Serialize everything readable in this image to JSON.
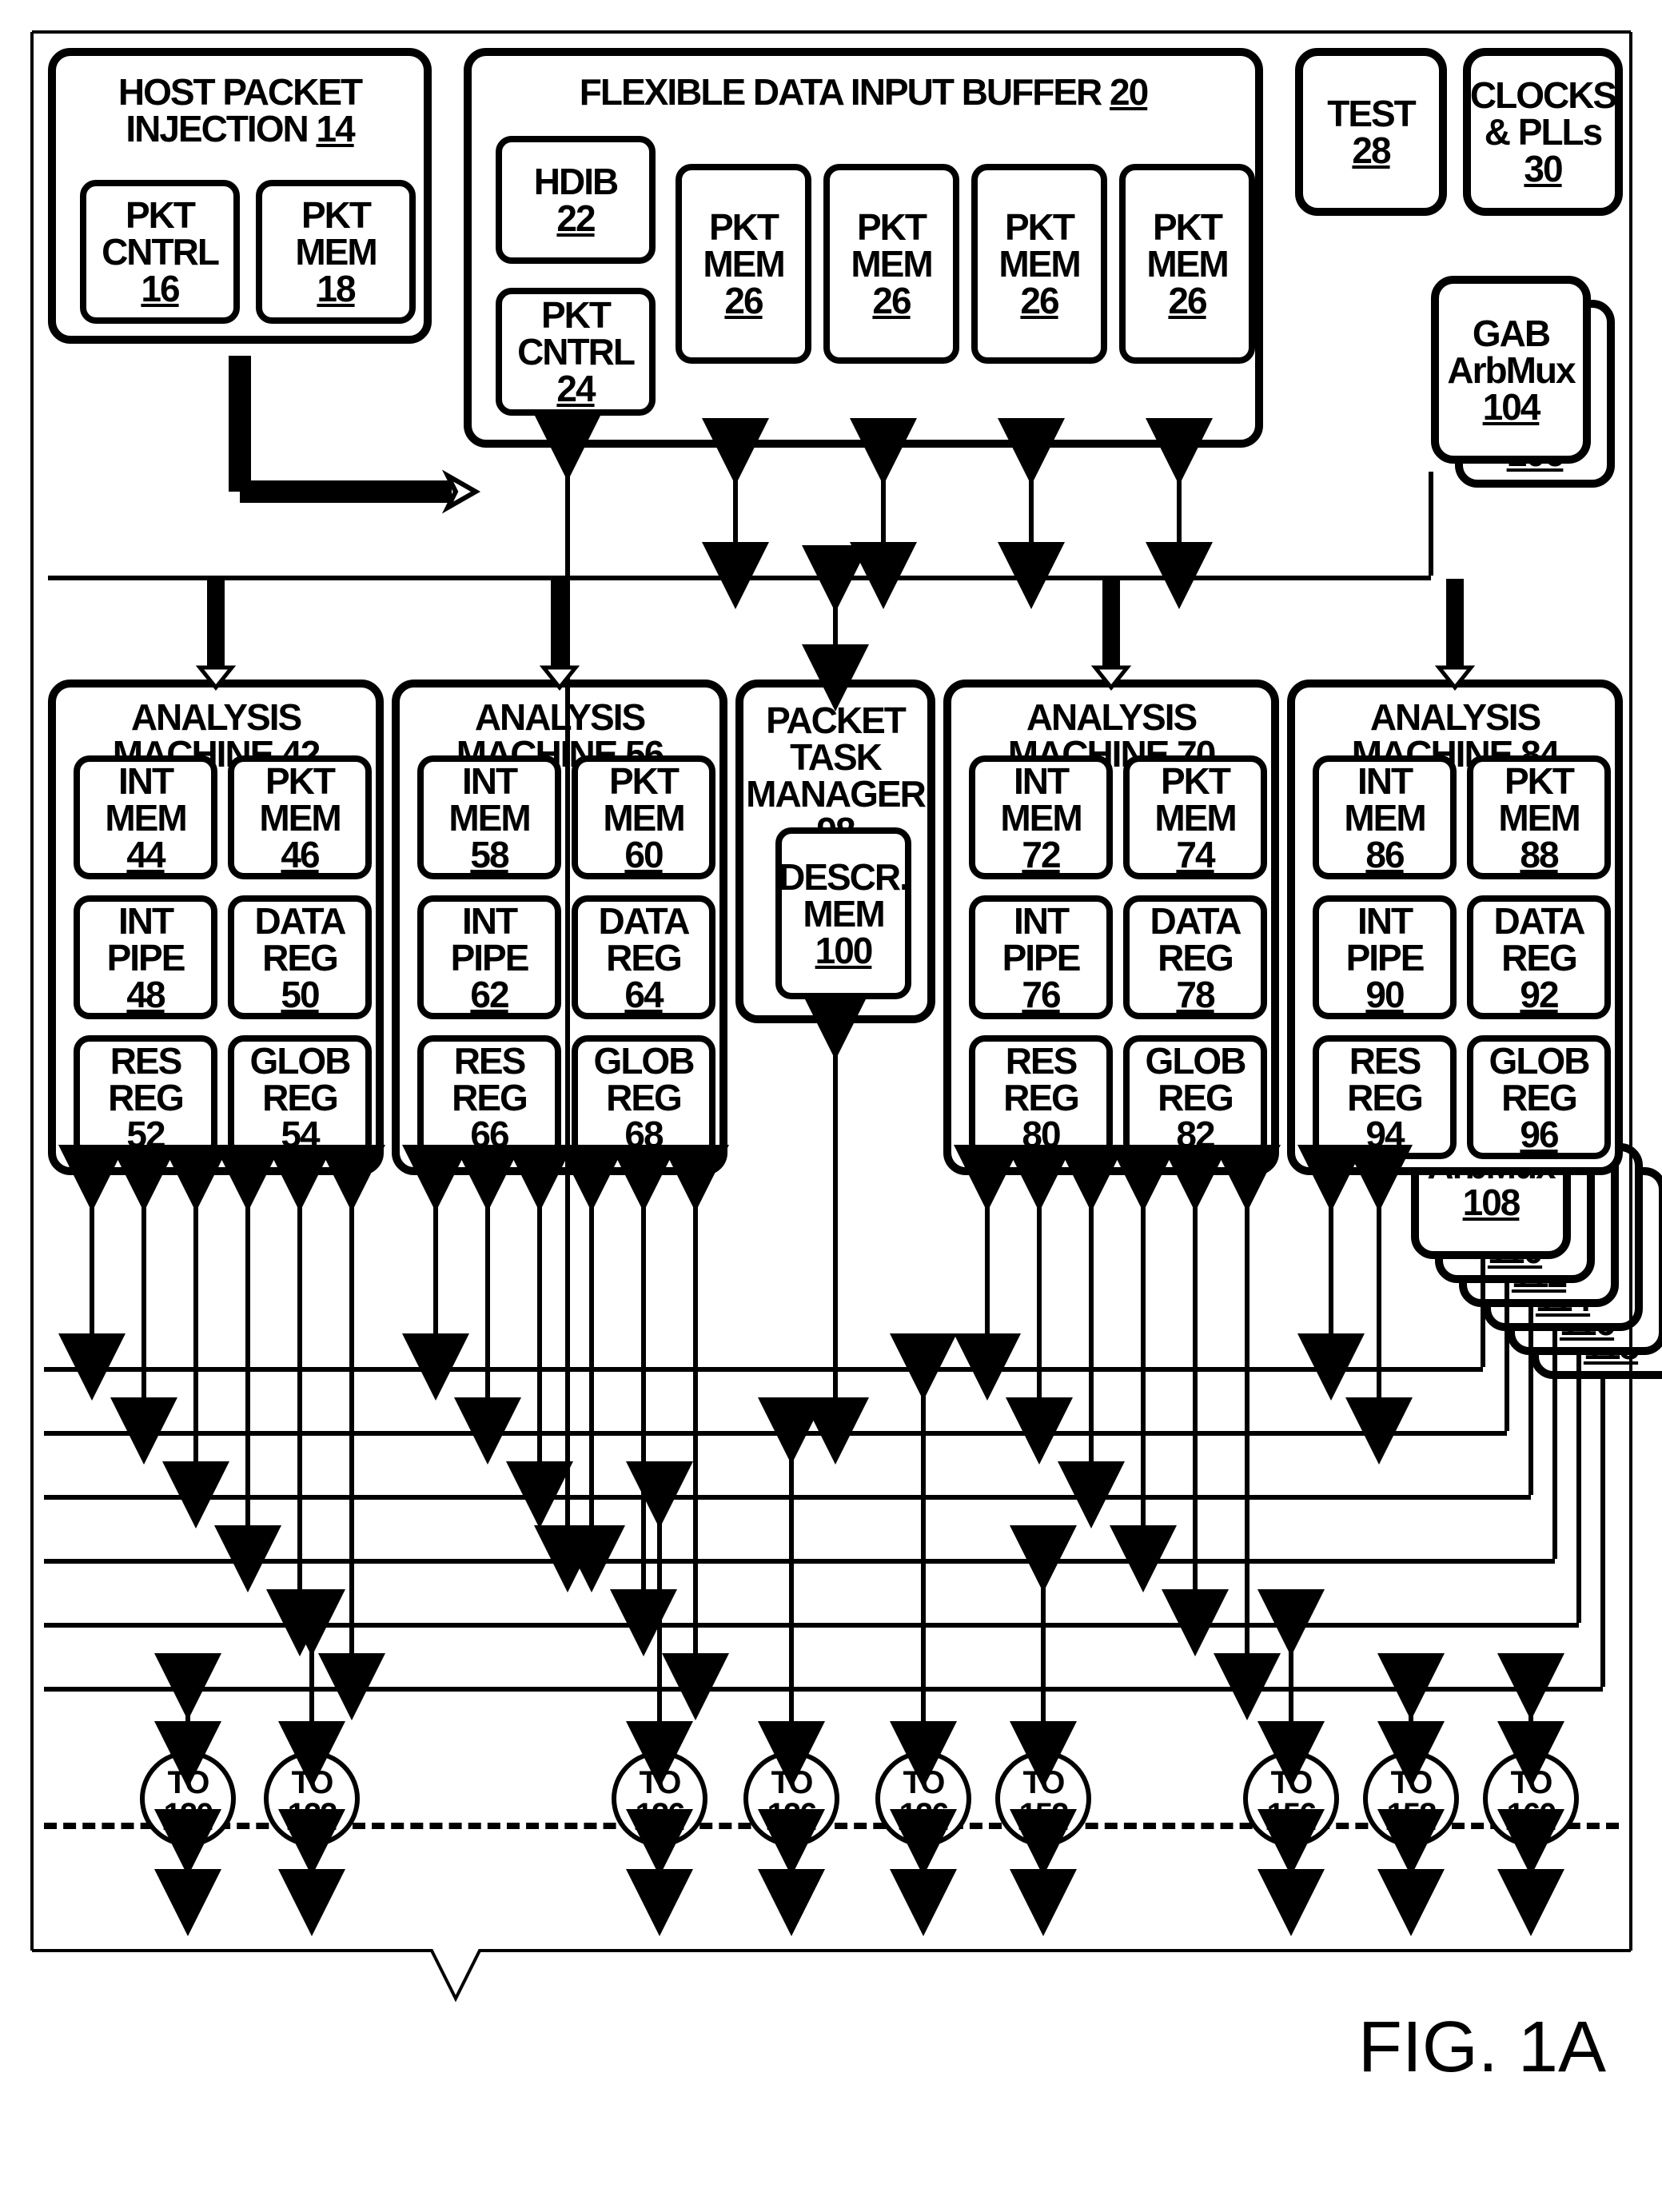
{
  "figure_label": "FIG. 1A",
  "chart_data": {
    "type": "block-diagram",
    "blocks": [
      {
        "id": 14,
        "name": "HOST PACKET INJECTION",
        "children": [
          {
            "id": 16,
            "name": "PKT CNTRL"
          },
          {
            "id": 18,
            "name": "PKT MEM"
          }
        ]
      },
      {
        "id": 20,
        "name": "FLEXIBLE DATA INPUT BUFFER",
        "children": [
          {
            "id": 22,
            "name": "HDIB"
          },
          {
            "id": 24,
            "name": "PKT CNTRL"
          },
          {
            "id": 26,
            "name": "PKT MEM",
            "count": 4
          }
        ]
      },
      {
        "id": 28,
        "name": "TEST"
      },
      {
        "id": 30,
        "name": "CLOCKS & PLLs"
      },
      {
        "id": 42,
        "name": "ANALYSIS MACHINE",
        "children": [
          {
            "id": 44,
            "name": "INT MEM"
          },
          {
            "id": 46,
            "name": "PKT MEM"
          },
          {
            "id": 48,
            "name": "INT PIPE"
          },
          {
            "id": 50,
            "name": "DATA REG"
          },
          {
            "id": 52,
            "name": "RES REG"
          },
          {
            "id": 54,
            "name": "GLOB REG"
          }
        ]
      },
      {
        "id": 56,
        "name": "ANALYSIS MACHINE",
        "children": [
          {
            "id": 58,
            "name": "INT MEM"
          },
          {
            "id": 60,
            "name": "PKT MEM"
          },
          {
            "id": 62,
            "name": "INT PIPE"
          },
          {
            "id": 64,
            "name": "DATA REG"
          },
          {
            "id": 66,
            "name": "RES REG"
          },
          {
            "id": 68,
            "name": "GLOB REG"
          }
        ]
      },
      {
        "id": 70,
        "name": "ANALYSIS MACHINE",
        "children": [
          {
            "id": 72,
            "name": "INT MEM"
          },
          {
            "id": 74,
            "name": "PKT MEM"
          },
          {
            "id": 76,
            "name": "INT PIPE"
          },
          {
            "id": 78,
            "name": "DATA REG"
          },
          {
            "id": 80,
            "name": "RES REG"
          },
          {
            "id": 82,
            "name": "GLOB REG"
          }
        ]
      },
      {
        "id": 84,
        "name": "ANALYSIS MACHINE",
        "children": [
          {
            "id": 86,
            "name": "INT MEM"
          },
          {
            "id": 88,
            "name": "PKT MEM"
          },
          {
            "id": 90,
            "name": "INT PIPE"
          },
          {
            "id": 92,
            "name": "DATA REG"
          },
          {
            "id": 94,
            "name": "RES REG"
          },
          {
            "id": 96,
            "name": "GLOB REG"
          }
        ]
      },
      {
        "id": 98,
        "name": "PACKET TASK MANAGER",
        "children": [
          {
            "id": 100,
            "name": "DESCR. MEM"
          }
        ]
      },
      {
        "id": 104,
        "name": "GAB ArbMux"
      },
      {
        "id": 106,
        "name": "(stacked)"
      },
      {
        "id": 108,
        "name": "GAB ArbMux"
      },
      {
        "id": 110,
        "name": "(stacked)"
      },
      {
        "id": 112,
        "name": "(stacked)"
      },
      {
        "id": 114,
        "name": "(stacked)"
      },
      {
        "id": 116,
        "name": "(stacked)"
      },
      {
        "id": 118,
        "name": "(stacked)"
      }
    ],
    "off_page_connectors": [
      120,
      122,
      126,
      126,
      126,
      152,
      156,
      158,
      160
    ],
    "buses": [
      "GAB-bus-1",
      "GAB-bus-2",
      "GAB-bus-3",
      "GAB-bus-4",
      "GAB-bus-5",
      "GAB-bus-6",
      "dashed-connector"
    ]
  },
  "boxes": {
    "host_inj": {
      "title_line1": "HOST PACKET",
      "title_line2": "INJECTION",
      "num": "14"
    },
    "pkt_cntrl_16": {
      "line1": "PKT CNTRL",
      "num": "16"
    },
    "pkt_mem_18": {
      "line1": "PKT MEM",
      "num": "18"
    },
    "fdib": {
      "title": "FLEXIBLE DATA INPUT BUFFER",
      "num": "20"
    },
    "hdib": {
      "line1": "HDIB",
      "num": "22"
    },
    "pkt_cntrl_24": {
      "line1": "PKT CNTRL",
      "num": "24"
    },
    "pkt_mem_26": {
      "line1": "PKT MEM",
      "num": "26"
    },
    "test": {
      "line1": "TEST",
      "num": "28"
    },
    "clocks": {
      "line1": "CLOCKS",
      "line2": "& PLLs",
      "num": "30"
    },
    "gab_104": {
      "line1": "GAB",
      "line2": "ArbMux",
      "num": "104"
    },
    "gab_106": {
      "num": "106"
    },
    "gab_108": {
      "line1": "GAB",
      "line2": "ArbMux",
      "num": "108"
    },
    "gab_110": {
      "num": "110"
    },
    "gab_112": {
      "num": "112"
    },
    "gab_114": {
      "num": "114"
    },
    "gab_116": {
      "num": "116"
    },
    "gab_118": {
      "num": "118"
    },
    "ptm": {
      "line1": "PACKET TASK",
      "line2": "MANAGER",
      "num": "98"
    },
    "descr_mem": {
      "line1": "DESCR.",
      "line2": "MEM",
      "num": "100"
    },
    "am42": {
      "title": "ANALYSIS MACHINE",
      "num": "42",
      "c": {
        "int_mem": "44",
        "pkt_mem": "46",
        "int_pipe": "48",
        "data_reg": "50",
        "res_reg": "52",
        "glob_reg": "54"
      }
    },
    "am56": {
      "title": "ANALYSIS MACHINE",
      "num": "56",
      "c": {
        "int_mem": "58",
        "pkt_mem": "60",
        "int_pipe": "62",
        "data_reg": "64",
        "res_reg": "66",
        "glob_reg": "68"
      }
    },
    "am70": {
      "title": "ANALYSIS MACHINE",
      "num": "70",
      "c": {
        "int_mem": "72",
        "pkt_mem": "74",
        "int_pipe": "76",
        "data_reg": "78",
        "res_reg": "80",
        "glob_reg": "82"
      }
    },
    "am84": {
      "title": "ANALYSIS MACHINE",
      "num": "84",
      "c": {
        "int_mem": "86",
        "pkt_mem": "88",
        "int_pipe": "90",
        "data_reg": "92",
        "res_reg": "94",
        "glob_reg": "96"
      }
    }
  },
  "am_labels": {
    "int_mem": "INT MEM",
    "pkt_mem": "PKT MEM",
    "int_pipe": "INT PIPE",
    "data_reg": "DATA REG",
    "res_reg": "RES REG",
    "glob_reg": "GLOB REG"
  },
  "circles": {
    "c120": {
      "line1": "TO",
      "num": "120"
    },
    "c122": {
      "line1": "TO",
      "num": "122"
    },
    "c126a": {
      "line1": "TO",
      "num": "126"
    },
    "c126b": {
      "line1": "TO",
      "num": "126"
    },
    "c126c": {
      "line1": "TO",
      "num": "126"
    },
    "c152": {
      "line1": "TO",
      "num": "152"
    },
    "c156": {
      "line1": "TO",
      "num": "156"
    },
    "c158": {
      "line1": "TO",
      "num": "158"
    },
    "c160": {
      "line1": "TO",
      "num": "160"
    }
  }
}
